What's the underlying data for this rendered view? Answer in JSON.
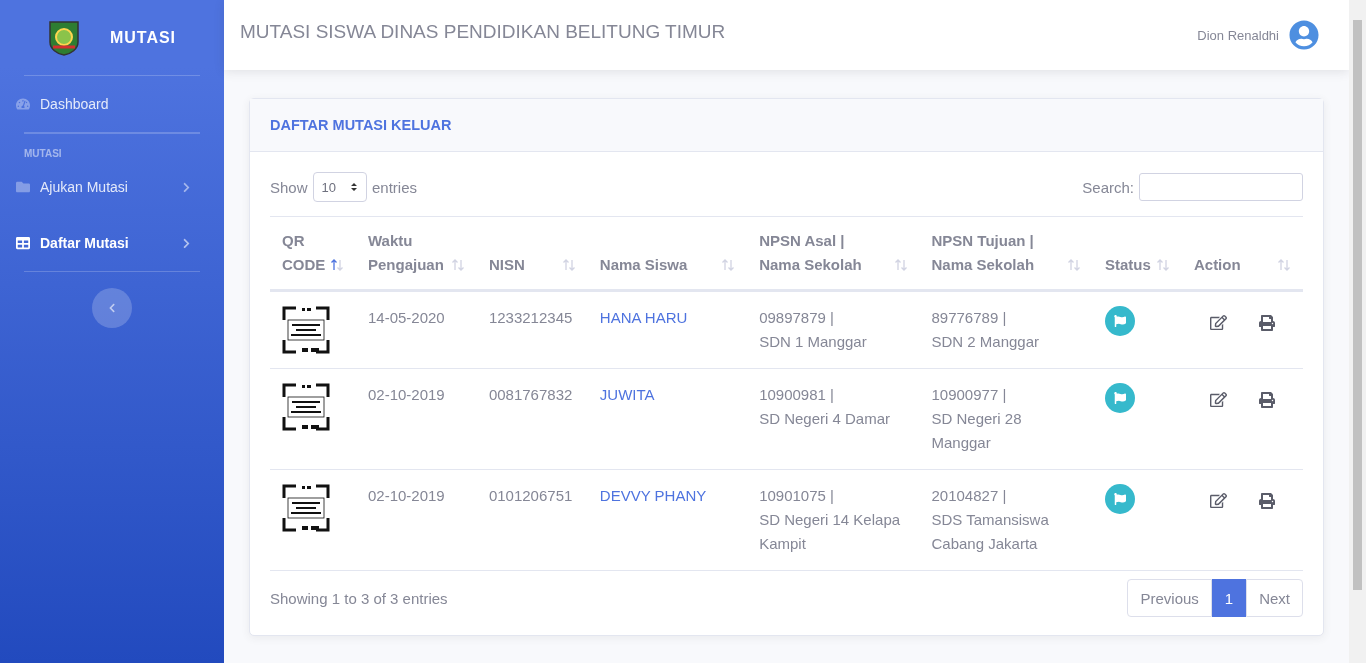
{
  "sidebar": {
    "brand": "MUTASI",
    "items": [
      {
        "kind": "link",
        "label": "Dashboard",
        "selected": false
      },
      {
        "kind": "heading",
        "label": "MUTASI"
      },
      {
        "kind": "menu",
        "label": "Ajukan Mutasi",
        "selected": false
      },
      {
        "kind": "menu",
        "label": "Daftar Mutasi",
        "selected": true
      }
    ]
  },
  "topbar": {
    "title": "MUTASI SISWA DINAS PENDIDIKAN BELITUNG TIMUR",
    "user": "Dion Renaldhi"
  },
  "card": {
    "title": "DAFTAR MUTASI KELUAR",
    "length": {
      "before": "Show",
      "value": "10",
      "after": "entries"
    },
    "search": {
      "label": "Search:"
    },
    "columns": [
      {
        "label": "QR CODE",
        "sorted": true
      },
      {
        "label": "Waktu Pengajuan",
        "sorted": false
      },
      {
        "label": "NISN",
        "sorted": false
      },
      {
        "label": "Nama Siswa",
        "sorted": false
      },
      {
        "label": "NPSN Asal |\nNama Sekolah",
        "sorted": false
      },
      {
        "label": "NPSN Tujuan |\nNama Sekolah",
        "sorted": false
      },
      {
        "label": "Status",
        "sorted": false
      },
      {
        "label": "Action",
        "sorted": false
      }
    ],
    "rows": [
      {
        "date": "14-05-2020",
        "nisn": "1233212345",
        "name": "HANA HARU",
        "from": "09897879 |\nSDN 1 Manggar",
        "to": "89776789 |\nSDN 2 Manggar"
      },
      {
        "date": "02-10-2019",
        "nisn": "0081767832",
        "name": "JUWITA",
        "from": "10900981 |\nSD Negeri 4 Damar",
        "to": "10900977 |\nSD Negeri 28 Manggar"
      },
      {
        "date": "02-10-2019",
        "nisn": "0101206751",
        "name": "DEVVY PHANY",
        "from": "10901075 |\nSD Negeri 14 Kelapa Kampit",
        "to": "20104827 |\nSDS Tamansiswa Cabang Jakarta"
      }
    ],
    "info": "Showing 1 to 3 of 3 entries",
    "pagination": [
      {
        "label": "Previous",
        "selected": false
      },
      {
        "label": "1",
        "selected": true
      },
      {
        "label": "Next",
        "selected": false
      }
    ]
  }
}
